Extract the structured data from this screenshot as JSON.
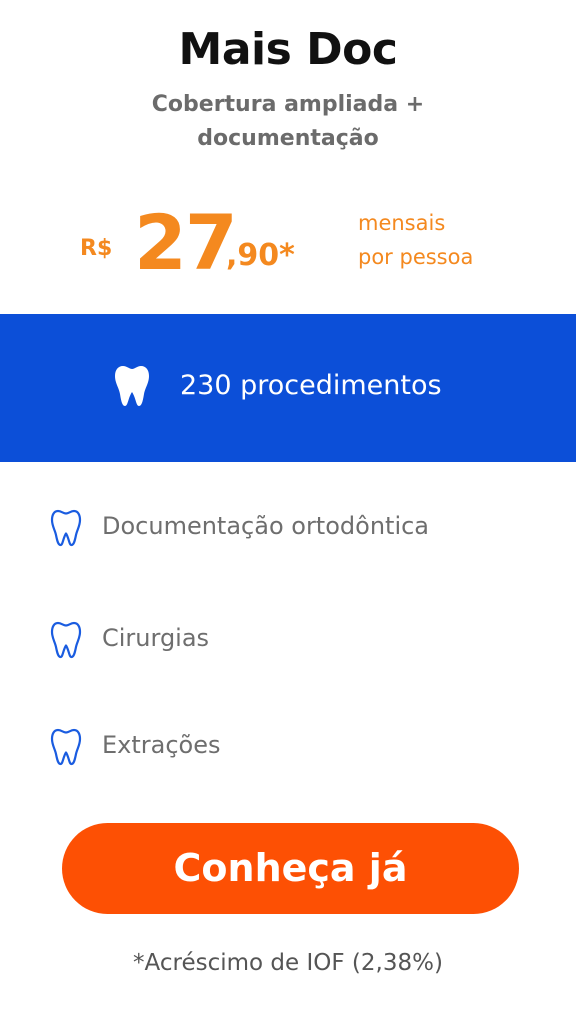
{
  "plan": {
    "title": "Mais Doc",
    "subtitle": "Cobertura ampliada + documentação"
  },
  "price": {
    "currency": "R$",
    "integer": "27",
    "cents": ",90*",
    "period_line1": "mensais",
    "period_line2": "por pessoa",
    "accent_color": "#f4891f"
  },
  "banner": {
    "icon": "tooth-icon",
    "text": "230 procedimentos",
    "background_color": "#0c4fd8"
  },
  "features": [
    {
      "icon": "tooth-outline-icon",
      "label": "Documentação ortodôntica"
    },
    {
      "icon": "tooth-outline-icon",
      "label": "Cirurgias"
    },
    {
      "icon": "tooth-outline-icon",
      "label": "Extrações"
    }
  ],
  "cta": {
    "label": "Conheça já",
    "color": "#fd5004"
  },
  "footnote": "*Acréscimo de IOF (2,38%)"
}
